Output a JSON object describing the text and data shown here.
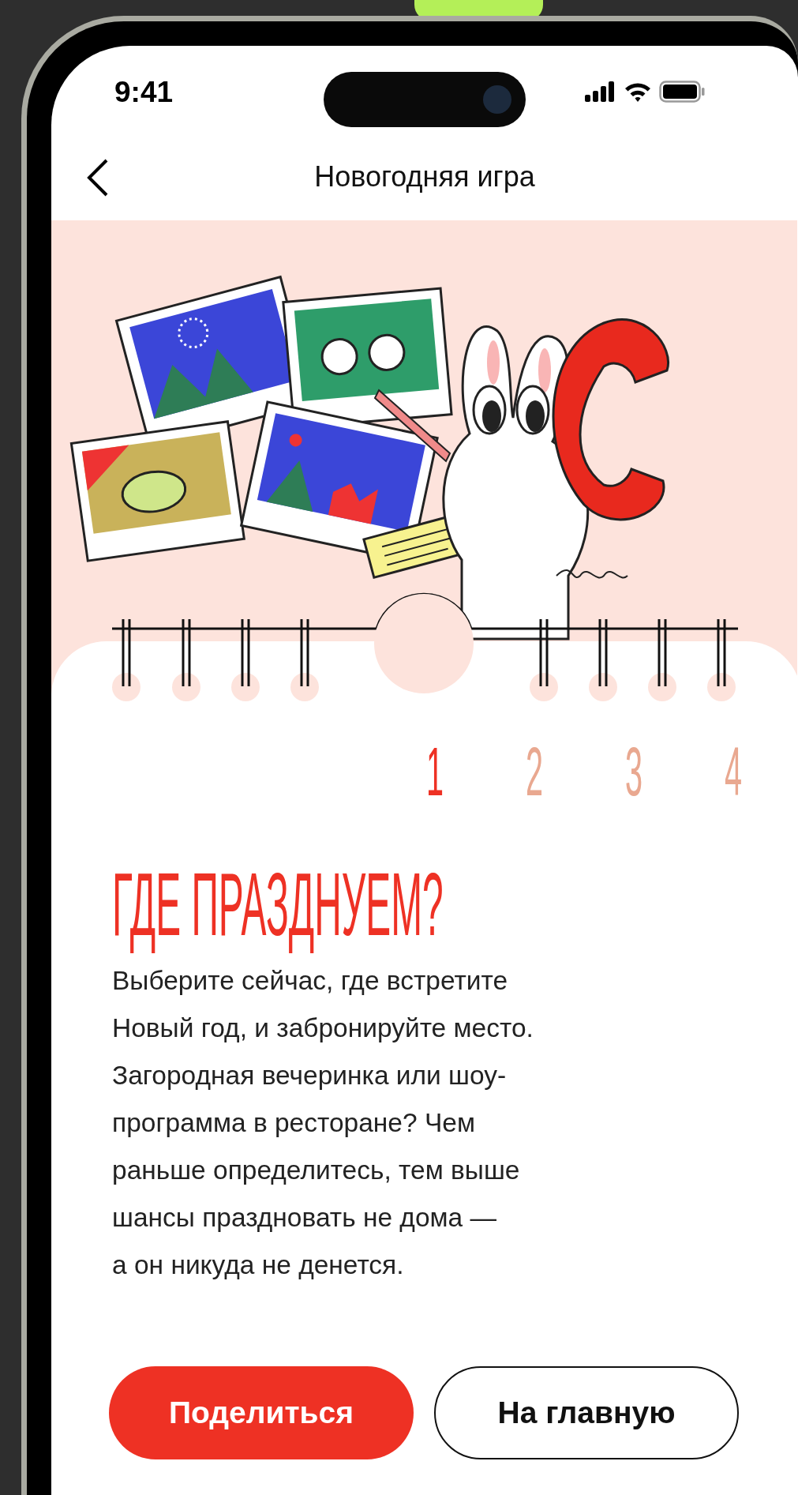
{
  "status_bar": {
    "time": "9:41"
  },
  "nav": {
    "title": "Новогодняя игра"
  },
  "steps": [
    {
      "label": "1",
      "selected": true
    },
    {
      "label": "2",
      "selected": false
    },
    {
      "label": "3",
      "selected": false
    },
    {
      "label": "4",
      "selected": false
    }
  ],
  "heading": "ГДЕ ПРАЗДНУЕМ?",
  "body": "Выберите сейчас, где встретите\nНовый год, и забронируйте место.\nЗагородная вечеринка или шоу-\nпрограмма в ресторане? Чем\nраньше определитесь, тем выше\nшансы праздновать не дома —\nа он никуда не денется.",
  "buttons": [
    {
      "label": "Поделиться",
      "kind": "primary"
    },
    {
      "label": "На главную",
      "kind": "outline"
    }
  ]
}
